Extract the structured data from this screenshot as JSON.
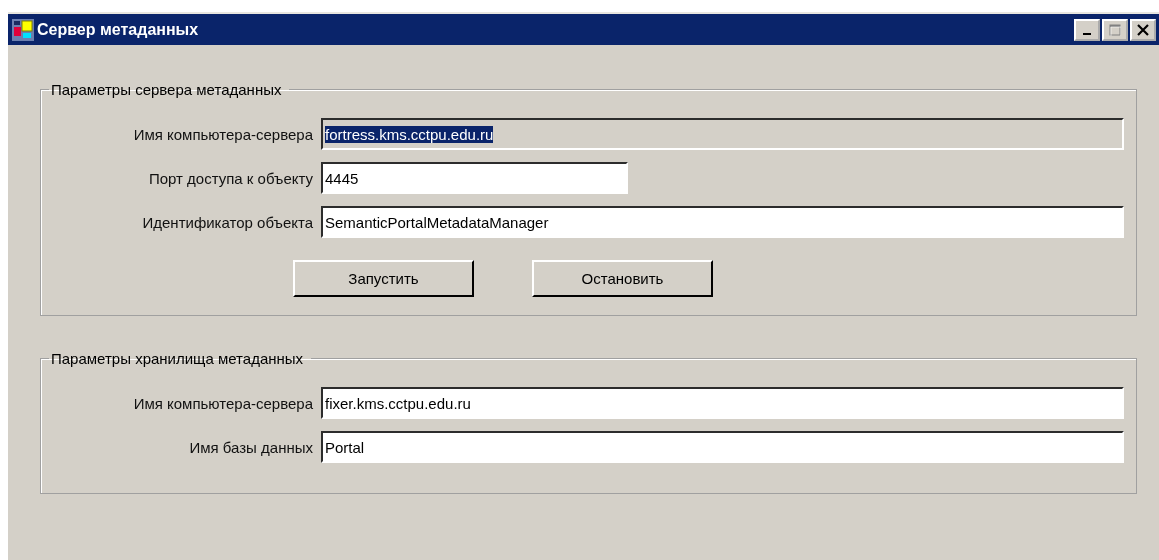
{
  "window": {
    "title": "Сервер метаданных",
    "controls": [
      {
        "kind": "minimize",
        "disabled": false
      },
      {
        "kind": "maximize",
        "disabled": true
      },
      {
        "kind": "close",
        "disabled": false
      }
    ]
  },
  "groups": [
    {
      "title": "Параметры сервера метаданных",
      "fields": [
        {
          "label": "Имя компьютера-сервера",
          "value": "fortress.kms.cctpu.edu.ru",
          "kind": "text",
          "disabled": true,
          "text_selected": true
        },
        {
          "label": "Порт доступа к объекту",
          "value": "4445",
          "kind": "number",
          "disabled": false,
          "text_selected": false
        },
        {
          "label": "Идентификатор объекта",
          "value": "SemanticPortalMetadataManager",
          "kind": "text",
          "disabled": false,
          "text_selected": false
        }
      ],
      "buttons": [
        "Запустить",
        "Остановить"
      ]
    },
    {
      "title": "Параметры хранилища метаданных",
      "fields": [
        {
          "label": "Имя компьютера-сервера",
          "value": "fixer.kms.cctpu.edu.ru",
          "kind": "text",
          "disabled": false,
          "text_selected": false
        },
        {
          "label": "Имя базы данных",
          "value": "Portal",
          "kind": "text",
          "disabled": false,
          "text_selected": false
        }
      ]
    }
  ]
}
